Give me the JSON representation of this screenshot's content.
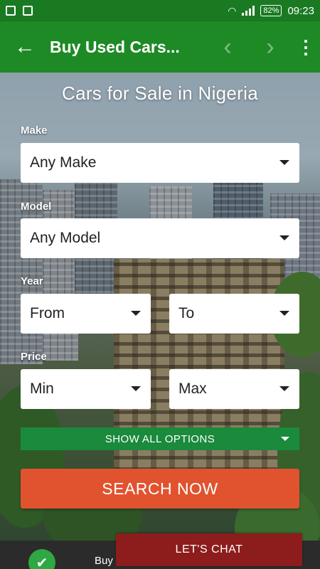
{
  "status_bar": {
    "battery": "82%",
    "time": "09:23"
  },
  "toolbar": {
    "title": "Buy Used Cars...",
    "back": "←",
    "prev": "‹",
    "next": "›",
    "menu": "⋮"
  },
  "heading": "Cars for Sale in Nigeria",
  "form": {
    "make": {
      "label": "Make",
      "value": "Any Make"
    },
    "model": {
      "label": "Model",
      "value": "Any Model"
    },
    "year": {
      "label": "Year",
      "from": "From",
      "to": "To"
    },
    "price": {
      "label": "Price",
      "min": "Min",
      "max": "Max"
    }
  },
  "show_all_label": "SHOW ALL OPTIONS",
  "search_label": "SEARCH NOW",
  "bottom_nav": {
    "buy_label": "Buy",
    "chat_label": "LET'S CHAT"
  },
  "colors": {
    "toolbar": "#1e8a25",
    "search": "#e0532e",
    "show_all": "#1a8a3c",
    "chat": "#8d1c1c"
  }
}
